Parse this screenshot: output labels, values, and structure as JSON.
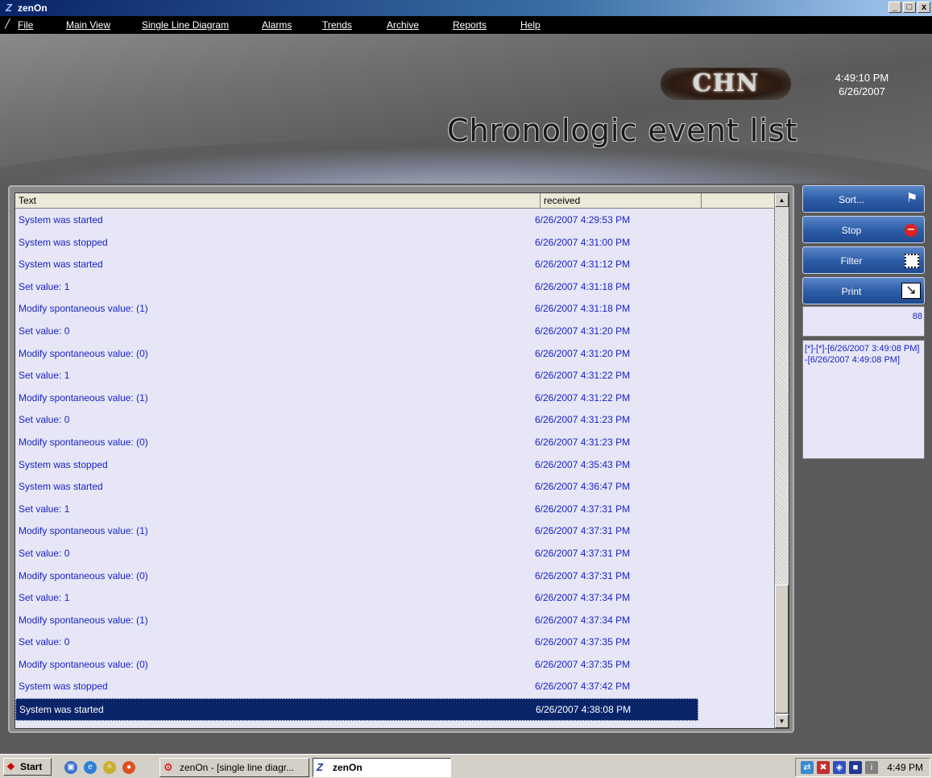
{
  "window": {
    "title": "zenOn",
    "min": "_",
    "max": "□",
    "close": "x"
  },
  "menu": {
    "items": [
      {
        "label": "File",
        "key": "file"
      },
      {
        "label": "Main View",
        "key": "main_view"
      },
      {
        "label": "Single Line Diagram",
        "key": "single_line"
      },
      {
        "label": "Alarms",
        "key": "alarms"
      },
      {
        "label": "Trends",
        "key": "trends"
      },
      {
        "label": "Archive",
        "key": "archive"
      },
      {
        "label": "Reports",
        "key": "reports"
      },
      {
        "label": "Help",
        "key": "help"
      }
    ]
  },
  "header": {
    "logo_text": "CHN",
    "time": "4:49:10 PM",
    "date": "6/26/2007",
    "title": "Chronologic event list"
  },
  "list": {
    "columns": {
      "text": "Text",
      "received": "received"
    },
    "rows": [
      {
        "text": "System was started",
        "received": "6/26/2007 4:29:53 PM"
      },
      {
        "text": "System was stopped",
        "received": "6/26/2007 4:31:00 PM"
      },
      {
        "text": "System was started",
        "received": "6/26/2007 4:31:12 PM"
      },
      {
        "text": "Set value: 1",
        "received": "6/26/2007 4:31:18 PM"
      },
      {
        "text": "Modify spontaneous value: (1)",
        "received": "6/26/2007 4:31:18 PM"
      },
      {
        "text": "Set value: 0",
        "received": "6/26/2007 4:31:20 PM"
      },
      {
        "text": "Modify spontaneous value: (0)",
        "received": "6/26/2007 4:31:20 PM"
      },
      {
        "text": "Set value: 1",
        "received": "6/26/2007 4:31:22 PM"
      },
      {
        "text": "Modify spontaneous value: (1)",
        "received": "6/26/2007 4:31:22 PM"
      },
      {
        "text": "Set value: 0",
        "received": "6/26/2007 4:31:23 PM"
      },
      {
        "text": "Modify spontaneous value: (0)",
        "received": "6/26/2007 4:31:23 PM"
      },
      {
        "text": "System was stopped",
        "received": "6/26/2007 4:35:43 PM"
      },
      {
        "text": "System was started",
        "received": "6/26/2007 4:36:47 PM"
      },
      {
        "text": "Set value: 1",
        "received": "6/26/2007 4:37:31 PM"
      },
      {
        "text": "Modify spontaneous value: (1)",
        "received": "6/26/2007 4:37:31 PM"
      },
      {
        "text": "Set value: 0",
        "received": "6/26/2007 4:37:31 PM"
      },
      {
        "text": "Modify spontaneous value: (0)",
        "received": "6/26/2007 4:37:31 PM"
      },
      {
        "text": "Set value: 1",
        "received": "6/26/2007 4:37:34 PM"
      },
      {
        "text": "Modify spontaneous value: (1)",
        "received": "6/26/2007 4:37:34 PM"
      },
      {
        "text": "Set value: 0",
        "received": "6/26/2007 4:37:35 PM"
      },
      {
        "text": "Modify spontaneous value: (0)",
        "received": "6/26/2007 4:37:35 PM"
      },
      {
        "text": "System was stopped",
        "received": "6/26/2007 4:37:42 PM"
      },
      {
        "text": "System was started",
        "received": "6/26/2007 4:38:08 PM",
        "selected": true
      }
    ]
  },
  "side": {
    "sort": "Sort...",
    "stop": "Stop",
    "filter": "Filter",
    "print": "Print",
    "count": "88",
    "filter_text": "[*]-[*]-[6/26/2007 3:49:08 PM]-[6/26/2007 4:49:08 PM]"
  },
  "taskbar": {
    "start": "Start",
    "tasks": [
      {
        "label": "zenOn - [single line diagr...",
        "active": false
      },
      {
        "label": "zenOn",
        "active": true
      }
    ],
    "clock": "4:49 PM"
  },
  "colors": {
    "accent": "#0a246a",
    "list_text": "#1a23c8",
    "list_bg": "#e6e6f6",
    "button_blue": "#2f5ea8"
  }
}
